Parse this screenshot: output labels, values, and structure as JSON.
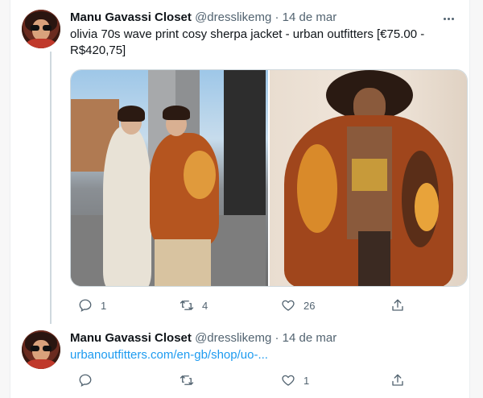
{
  "tweets": [
    {
      "display_name": "Manu Gavassi Closet",
      "handle": "@dresslikemg",
      "separator": "·",
      "date": "14 de mar",
      "text": "olivia 70s wave print cosy sherpa jacket - urban outfitters [€75.00 - R$420,75]",
      "replies": "1",
      "retweets": "4",
      "likes": "26"
    },
    {
      "display_name": "Manu Gavassi Closet",
      "handle": "@dresslikemg",
      "separator": "·",
      "date": "14 de mar",
      "link": "urbanoutfitters.com/en-gb/shop/uo-...",
      "replies": "",
      "retweets": "",
      "likes": "1"
    }
  ],
  "icons": {
    "reply": "reply-icon",
    "retweet": "retweet-icon",
    "like": "heart-icon",
    "share": "share-icon",
    "more": "more-options-icon"
  },
  "colors": {
    "link": "#1d9bf0",
    "meta": "#536471",
    "thread_line": "#cfd9de"
  }
}
